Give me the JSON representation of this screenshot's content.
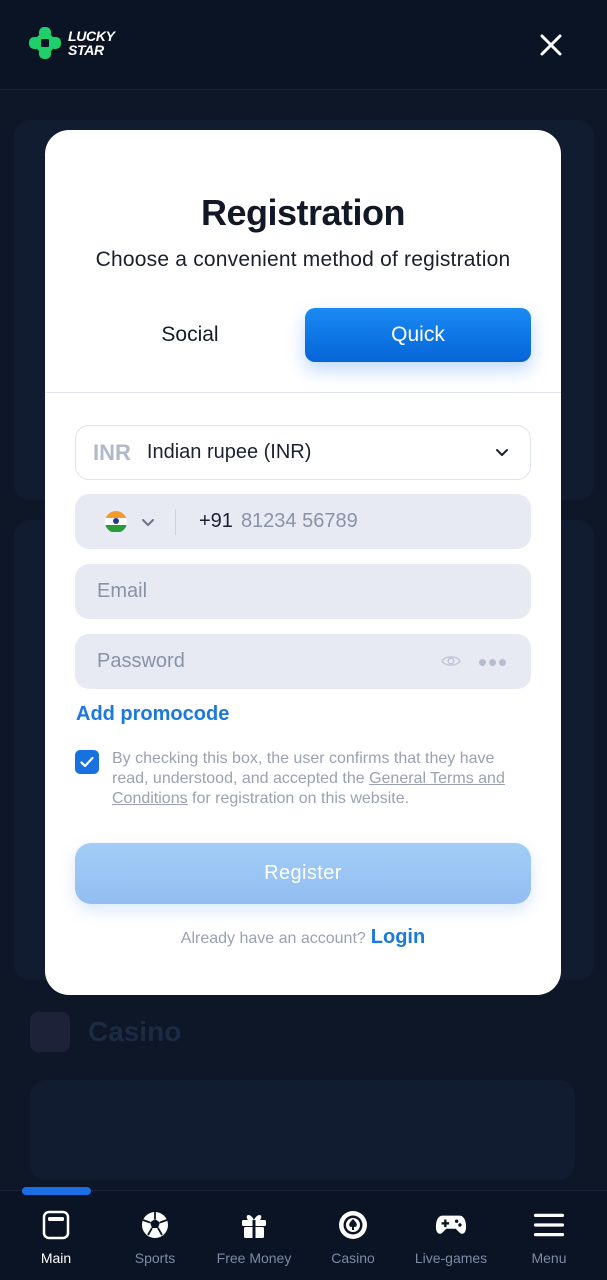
{
  "header": {
    "logo_line1": "LUCKY",
    "logo_line2": "STAR",
    "close_icon": "close-icon"
  },
  "background": {
    "section_title": "Casino"
  },
  "modal": {
    "title": "Registration",
    "subtitle": "Choose a convenient method of registration",
    "tabs": [
      {
        "label": "Social",
        "active": false
      },
      {
        "label": "Quick",
        "active": true
      }
    ],
    "currency": {
      "code": "INR",
      "name": "Indian rupee (INR)"
    },
    "phone": {
      "country_flag": "india-flag-icon",
      "dial_code": "+91",
      "placeholder": "81234 56789"
    },
    "email": {
      "placeholder": "Email"
    },
    "password": {
      "placeholder": "Password"
    },
    "promocode_link": "Add promocode",
    "consent": {
      "checked": true,
      "text_before": "By checking this box, the user confirms that they have read, understood, and accepted the ",
      "link_text": "General Terms and Conditions",
      "text_after": " for registration on this website."
    },
    "register_button": "Register",
    "account_prompt": "Already have an account?",
    "login_link": "Login"
  },
  "colors": {
    "accent": "#1772df",
    "primary_gradient_top": "#1a8af5",
    "primary_gradient_bottom": "#0665d6",
    "brand_green": "#1fcf6a",
    "nav_background": "#0b1424"
  },
  "bottom_nav": {
    "items": [
      {
        "label": "Main",
        "icon": "main-icon",
        "active": true
      },
      {
        "label": "Sports",
        "icon": "soccer-ball-icon",
        "active": false
      },
      {
        "label": "Free Money",
        "icon": "gift-icon",
        "active": false
      },
      {
        "label": "Casino",
        "icon": "casino-chip-icon",
        "active": false
      },
      {
        "label": "Live-games",
        "icon": "gamepad-icon",
        "active": false
      },
      {
        "label": "Menu",
        "icon": "menu-icon",
        "active": false
      }
    ]
  }
}
